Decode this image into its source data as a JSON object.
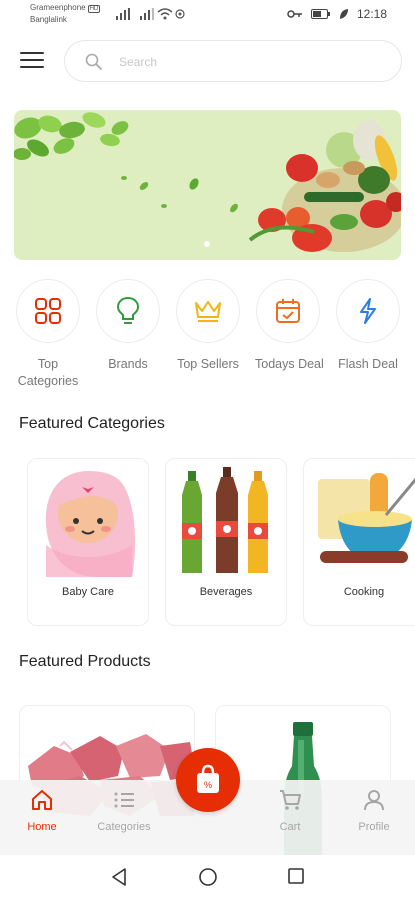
{
  "status_bar": {
    "carrier_1": "Grameenphone",
    "carrier_1_badge": "HD",
    "carrier_2": "Banglalink",
    "time": "12:18"
  },
  "header": {
    "search_placeholder": "Search"
  },
  "quick_links": [
    {
      "label": "Top Categories",
      "icon": "top-categories-icon",
      "color": "#e62e04"
    },
    {
      "label": "Brands",
      "icon": "bulb-icon",
      "color": "#2e9b3f"
    },
    {
      "label": "Top Sellers",
      "icon": "crown-icon",
      "color": "#f1b611"
    },
    {
      "label": "Todays Deal",
      "icon": "calendar-icon",
      "color": "#f36c1d"
    },
    {
      "label": "Flash Deal",
      "icon": "lightning-icon",
      "color": "#2d7de6"
    }
  ],
  "featured_categories": {
    "title": "Featured Categories",
    "items": [
      {
        "label": "Baby Care"
      },
      {
        "label": "Beverages"
      },
      {
        "label": "Cooking"
      }
    ]
  },
  "featured_products": {
    "title": "Featured Products"
  },
  "bottom_nav": {
    "items": [
      {
        "label": "Home",
        "icon": "home-icon",
        "active": true
      },
      {
        "label": "Categories",
        "icon": "list-icon",
        "active": false
      },
      {
        "label": "Cart",
        "icon": "cart-icon",
        "active": false
      },
      {
        "label": "Profile",
        "icon": "profile-icon",
        "active": false
      }
    ],
    "center_button_icon": "shopping-bag-icon"
  },
  "colors": {
    "accent": "#e62e04",
    "banner_bg": "#dfeec0"
  }
}
